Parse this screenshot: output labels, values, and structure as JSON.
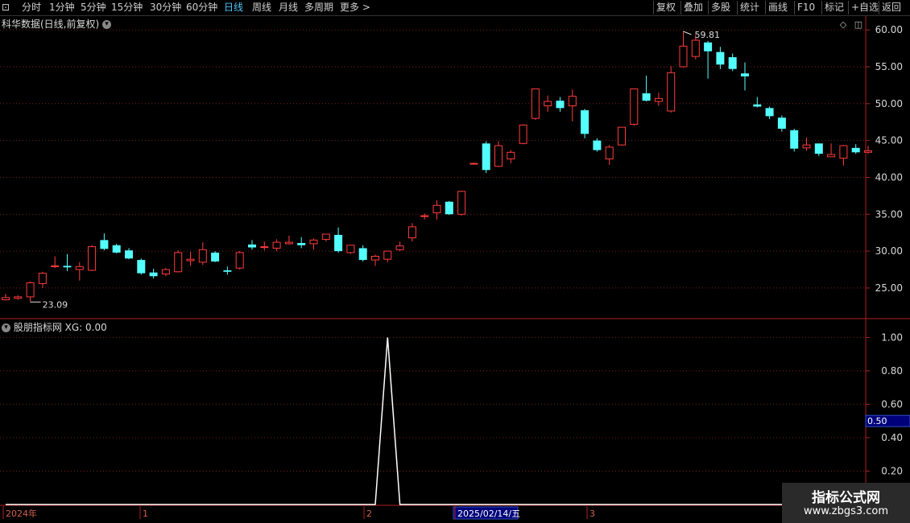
{
  "toolbar": {
    "periods": [
      "分时",
      "1分钟",
      "5分钟",
      "15分钟",
      "30分钟",
      "60分钟",
      "日线",
      "周线",
      "月线",
      "多周期",
      "更多 >"
    ],
    "active": "日线",
    "right": [
      "复权",
      "叠加",
      "多股",
      "统计",
      "画线",
      "F10",
      "标记",
      "+自选",
      "返回"
    ]
  },
  "main_chart": {
    "title": "科华数据(日线,前复权)",
    "y_ticks": [
      "60.00",
      "55.00",
      "50.00",
      "45.00",
      "40.00",
      "35.00",
      "30.00",
      "25.00"
    ],
    "high_label": "59.81",
    "low_label": "23.09"
  },
  "indicator_chart": {
    "title": "股朋指标网 XG: 0.00",
    "y_ticks": [
      "1.00",
      "0.80",
      "0.60",
      "0.40",
      "0.20"
    ],
    "cursor_value": "0.50"
  },
  "date_axis": {
    "labels": [
      "2024年",
      "1",
      "2",
      "2025/02/14/五",
      "3"
    ]
  },
  "watermark": {
    "line1": "指标公式网",
    "line2": "www.zbgs3.com"
  },
  "colors": {
    "up": "#ff3b3b",
    "down": "#54ffff",
    "grid": "#7a1f1f",
    "axis": "#b02020"
  },
  "chart_data": [
    {
      "type": "candlestick",
      "title": "科华数据(日线,前复权)",
      "ylim": [
        21.5,
        61
      ],
      "candles": [
        [
          23.4,
          24.2,
          23.3,
          23.7
        ],
        [
          23.6,
          24.0,
          23.4,
          23.8
        ],
        [
          23.8,
          25.9,
          23.1,
          25.7
        ],
        [
          25.6,
          27.2,
          25.0,
          27.0
        ],
        [
          27.9,
          29.3,
          27.7,
          28.0
        ],
        [
          28.0,
          29.6,
          27.3,
          27.8
        ],
        [
          27.5,
          28.5,
          26.0,
          27.9
        ],
        [
          27.4,
          30.8,
          27.3,
          30.6
        ],
        [
          31.5,
          32.4,
          30.1,
          30.3
        ],
        [
          30.8,
          31.0,
          29.7,
          29.8
        ],
        [
          30.1,
          30.4,
          28.9,
          29.0
        ],
        [
          28.8,
          29.0,
          26.8,
          27.0
        ],
        [
          27.1,
          27.6,
          26.3,
          26.6
        ],
        [
          26.9,
          27.7,
          26.6,
          27.5
        ],
        [
          27.2,
          30.1,
          27.1,
          29.8
        ],
        [
          28.7,
          29.9,
          28.0,
          28.9
        ],
        [
          28.5,
          31.2,
          28.1,
          30.2
        ],
        [
          29.8,
          30.0,
          28.5,
          28.6
        ],
        [
          27.4,
          27.9,
          26.8,
          27.2
        ],
        [
          27.7,
          30.0,
          27.5,
          29.8
        ],
        [
          30.9,
          31.5,
          30.2,
          30.5
        ],
        [
          30.5,
          31.3,
          30.1,
          30.6
        ],
        [
          30.4,
          31.6,
          30.0,
          31.2
        ],
        [
          31.0,
          32.1,
          30.9,
          31.2
        ],
        [
          31.1,
          31.9,
          30.4,
          30.8
        ],
        [
          31.0,
          31.7,
          30.2,
          31.5
        ],
        [
          31.6,
          32.3,
          31.3,
          32.3
        ],
        [
          32.2,
          33.2,
          29.8,
          30.0
        ],
        [
          29.8,
          30.8,
          29.6,
          30.8
        ],
        [
          30.4,
          30.8,
          28.6,
          28.8
        ],
        [
          28.8,
          29.5,
          28.0,
          29.3
        ],
        [
          28.9,
          30.0,
          28.5,
          30.0
        ],
        [
          30.2,
          31.3,
          30.0,
          30.7
        ],
        [
          31.8,
          33.8,
          31.3,
          33.3
        ],
        [
          34.7,
          35.1,
          34.3,
          34.8
        ],
        [
          35.2,
          36.9,
          34.3,
          36.2
        ],
        [
          36.7,
          36.8,
          34.9,
          35.0
        ],
        [
          35.0,
          38.2,
          34.8,
          38.1
        ],
        [
          41.9,
          42.0,
          41.8,
          41.9
        ],
        [
          44.6,
          44.9,
          40.6,
          41.0
        ],
        [
          41.5,
          44.9,
          41.4,
          44.3
        ],
        [
          42.5,
          43.7,
          41.9,
          43.4
        ],
        [
          44.6,
          47.2,
          44.5,
          47.1
        ],
        [
          48.0,
          52.0,
          47.8,
          52.0
        ],
        [
          49.7,
          51.1,
          48.9,
          50.3
        ],
        [
          50.4,
          50.9,
          48.9,
          49.4
        ],
        [
          49.7,
          51.9,
          47.6,
          51.0
        ],
        [
          49.1,
          49.3,
          45.3,
          45.9
        ],
        [
          45.0,
          45.3,
          43.5,
          43.7
        ],
        [
          42.5,
          44.4,
          41.7,
          44.1
        ],
        [
          44.4,
          46.3,
          44.3,
          46.8
        ],
        [
          47.2,
          52.0,
          47.0,
          52.0
        ],
        [
          51.4,
          53.8,
          50.3,
          50.4
        ],
        [
          50.3,
          51.5,
          49.7,
          50.7
        ],
        [
          49.0,
          55.1,
          48.8,
          54.2
        ],
        [
          55.0,
          59.8,
          54.9,
          57.8
        ],
        [
          56.4,
          59.3,
          56.0,
          58.6
        ],
        [
          58.3,
          58.5,
          53.4,
          57.1
        ],
        [
          57.0,
          57.7,
          54.7,
          55.3
        ],
        [
          56.3,
          56.8,
          54.4,
          54.7
        ],
        [
          54.1,
          55.6,
          51.8,
          53.7
        ],
        [
          49.9,
          50.9,
          49.5,
          49.6
        ],
        [
          49.4,
          49.6,
          47.9,
          48.3
        ],
        [
          48.1,
          48.4,
          46.2,
          46.6
        ],
        [
          46.4,
          46.6,
          43.5,
          43.9
        ],
        [
          44.0,
          45.4,
          43.6,
          44.4
        ],
        [
          44.6,
          44.6,
          42.9,
          43.2
        ],
        [
          42.8,
          44.6,
          42.8,
          43.1
        ],
        [
          42.6,
          44.4,
          41.6,
          44.3
        ],
        [
          44.0,
          44.5,
          43.2,
          43.4
        ],
        [
          43.4,
          44.3,
          43.2,
          43.6
        ]
      ]
    },
    {
      "type": "line",
      "title": "股朋指标网 XG: 0.00",
      "ylim": [
        0,
        1.05
      ],
      "series": [
        {
          "name": "XG",
          "values": [
            0,
            0,
            0,
            0,
            0,
            0,
            0,
            0,
            0,
            0,
            0,
            0,
            0,
            0,
            0,
            0,
            0,
            0,
            0,
            0,
            0,
            0,
            0,
            0,
            0,
            0,
            0,
            0,
            0,
            0,
            0,
            1,
            0,
            0,
            0,
            0,
            0,
            0,
            0,
            0,
            0,
            0,
            0,
            0,
            0,
            0,
            0,
            0,
            0,
            0,
            0,
            0,
            0,
            0,
            0,
            0,
            0,
            0,
            0,
            0,
            0,
            0,
            0,
            0,
            0,
            0,
            0,
            0,
            0,
            0,
            0
          ]
        }
      ]
    }
  ]
}
